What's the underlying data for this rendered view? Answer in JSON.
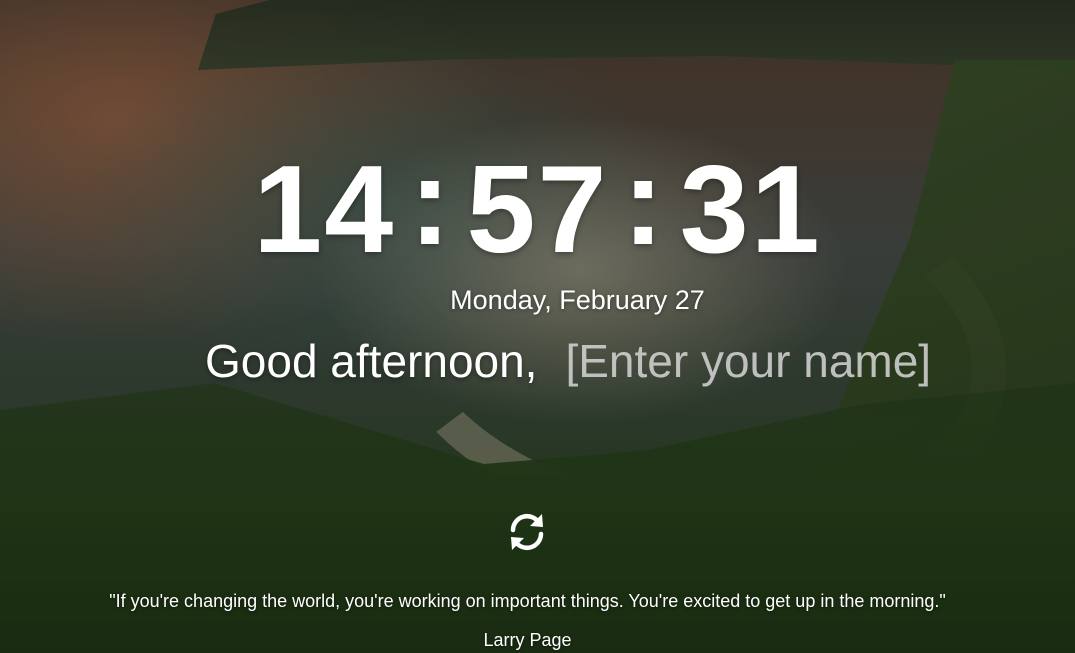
{
  "clock": {
    "hours": "14",
    "minutes": "57",
    "seconds": "31",
    "separator": ":"
  },
  "date": "Monday, February 27",
  "greeting": {
    "text": "Good afternoon,",
    "name_placeholder": "[Enter your name]",
    "name_value": ""
  },
  "refresh": {
    "icon": "refresh-icon"
  },
  "quote": {
    "text": "\"If you're changing the world, you're working on important things. You're excited to get up in the morning.\"",
    "author": "Larry Page"
  },
  "colors": {
    "text": "#ffffff",
    "placeholder": "#d7d7d7"
  }
}
